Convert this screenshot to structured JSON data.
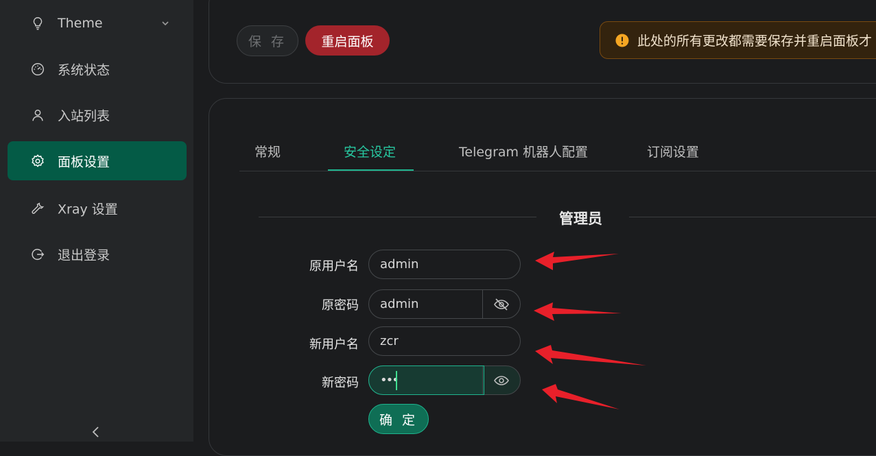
{
  "sidebar": {
    "items": [
      {
        "label": "Theme",
        "icon": "bulb-icon"
      },
      {
        "label": "系统状态",
        "icon": "dashboard-icon"
      },
      {
        "label": "入站列表",
        "icon": "user-icon"
      },
      {
        "label": "面板设置",
        "icon": "gear-icon"
      },
      {
        "label": "Xray 设置",
        "icon": "wrench-icon"
      },
      {
        "label": "退出登录",
        "icon": "logout-icon"
      }
    ],
    "active_index": 3,
    "collapse_icon": "chevron-left-icon"
  },
  "toolbar": {
    "save_label": "保 存",
    "restart_label": "重启面板",
    "alert_text": "此处的所有更改都需要保存并重启面板才"
  },
  "tabs": [
    {
      "label": "常规"
    },
    {
      "label": "安全设定"
    },
    {
      "label": "Telegram 机器人配置"
    },
    {
      "label": "订阅设置"
    }
  ],
  "active_tab": 1,
  "section": {
    "title": "管理员"
  },
  "form": {
    "old_username": {
      "label": "原用户名",
      "value": "admin"
    },
    "old_password": {
      "label": "原密码",
      "value": "admin"
    },
    "new_username": {
      "label": "新用户名",
      "value": "zcr"
    },
    "new_password": {
      "label": "新密码",
      "value": "•••"
    },
    "confirm_label": "确 定"
  },
  "colors": {
    "accent": "#1fb58f",
    "active_nav": "#045b46",
    "danger": "#a3242b",
    "warning": "#f5a623",
    "annotation_arrow": "#e8202a"
  }
}
